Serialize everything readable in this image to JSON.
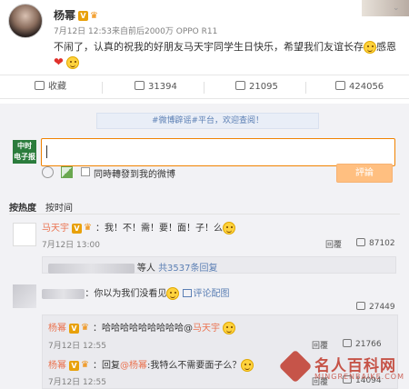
{
  "post": {
    "author": "杨幂",
    "meta": "7月12日 12:53来自前后2000万 OPPO R11",
    "text_before": "不闹了，认真的祝我的好朋友马天宇同学生日快乐，希望我们友谊长存",
    "text_after": "感恩",
    "accent_color": "#eb7350"
  },
  "actions": {
    "collect": "收藏",
    "forward_count": "31394",
    "comment_count": "21095",
    "like_count": "424056"
  },
  "composer": {
    "notice": "#微博辟谣#平台，欢迎查阅！",
    "logo": "中时 电子报",
    "checkbox_label": "同時轉發到我的微博",
    "submit_label": "評論"
  },
  "sort": {
    "hot": "按热度",
    "time": "按时间"
  },
  "comments": [
    {
      "user": "马天宇",
      "text": "：我！不！需！要！面！子！么",
      "time": "7月12日 13:00",
      "reply": "回覆",
      "likes": "87102",
      "sub_summary_mid": "等人",
      "sub_summary_link": "共3537条回复"
    },
    {
      "text_main": "：你以为我们没看见",
      "text_extra": "评论配图",
      "likes": "27449",
      "replies": [
        {
          "user": "杨幂",
          "text": "：哈哈哈哈哈哈哈哈哈@",
          "mention": "马天宇",
          "time": "7月12日 12:55",
          "reply": "回覆",
          "likes": "21766"
        },
        {
          "user": "杨幂",
          "text_pre": "：回复",
          "mention": "@杨幂",
          "text_post": ":我特么不需要面子么？",
          "time": "7月12日 12:55",
          "reply": "回覆",
          "likes": "14094"
        }
      ]
    }
  ],
  "watermark": {
    "title": "名人百科网",
    "subtitle": "MINGRENBAIKE.COM"
  }
}
